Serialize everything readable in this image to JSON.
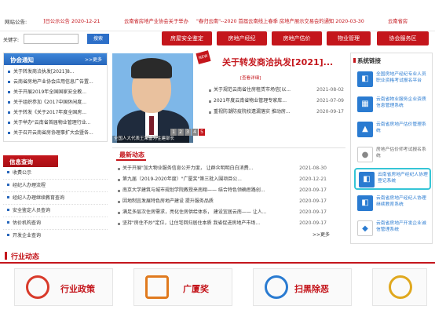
{
  "ticker": {
    "label": "网站公告:",
    "items": [
      {
        "text": "]日公示公告 2020-12-21"
      },
      {
        "text": "云南省房地产业协会关于举办"
      },
      {
        "text": "\"春归云南\"--2020 首届云南线上春季 房地产展示交易会的通知 2020-03-30"
      },
      {
        "text": "云南省房"
      }
    ]
  },
  "toolbar": {
    "keyword_label": "关键字:",
    "search_value": "",
    "search_button": "搜索",
    "nav": [
      "房屋安全鉴定",
      "房地产经纪",
      "房地产估价",
      "物业管理",
      "协会服务区"
    ]
  },
  "notice": {
    "title": "协会通知",
    "more": ">>更多",
    "items": [
      "关于转发商洽执发[2021]8...",
      "云南省房地产业协会应用信息广告置...",
      "关于开展2019年全国国家安全教...",
      "关于组织参加《2017中国休闲度...",
      "关于转发《关于2017年度全国房...",
      "关于举办\"云南省首届物业管理行业...",
      "关于召开云南省房协理事扩大会暨各..."
    ]
  },
  "info": {
    "title": "信息查询",
    "items": [
      "收费公示",
      "经纪人办理流程",
      "经纪人办理继续教育查询",
      "安全鉴定人员查询",
      "估价机构查询",
      "开发企业查询"
    ]
  },
  "feature": {
    "caption": "全国人大代表王荣富为住建部长",
    "pages": [
      "1",
      "2",
      "3",
      "4",
      "5"
    ],
    "active_page": 5,
    "new_badge": "NEW",
    "headline": "关于转发商洽执发[2021]...",
    "detail": "[查看详细]",
    "items": [
      {
        "text": "关于规范云南省住房租赁市场信[以...",
        "date": "2021-08-02"
      },
      {
        "text": "2021年度云南省物业管理专家库...",
        "date": "2021-07-09"
      },
      {
        "text": "重视防潮防疫院校遗漏落实 推动房...",
        "date": "2020-09-17"
      }
    ]
  },
  "news": {
    "title": "最新动态",
    "more": ">>更多",
    "items": [
      {
        "text": "关于开展\"加大物业服务信息公开力度， 让群众明明白白消费...",
        "date": "2021-08-30"
      },
      {
        "text": "第九届（2019-2020年度）\"广厦奖\"第三批入围项目公...",
        "date": "2020-12-21"
      },
      {
        "text": "南京大学建筑与城市规划学院教授来南翔—— 结合特色领确思路创...",
        "date": "2020-09-17"
      },
      {
        "text": "因地制宜发展特色房地产建设 提升服务品质",
        "date": "2020-09-17"
      },
      {
        "text": "满足多层次住房需求，亮化住房供给体系， 建设宜居云南—— 让人...",
        "date": "2020-09-17"
      },
      {
        "text": "坚持\"房住不炒\"定位，让住宅回归居住本质 我省促进房地产市场...",
        "date": "2020-09-17"
      }
    ]
  },
  "systems": {
    "title": "系统链接",
    "items": [
      {
        "text": "全国房地产经纪专业人员职业资格考试报名平台",
        "icon": "id-card-icon"
      },
      {
        "text": "云南省物业服务企业资质信息管理系统",
        "icon": "building-icon"
      },
      {
        "text": "云南省房地产估价管理系统",
        "icon": "chart-icon"
      },
      {
        "text": "房地产估价师考试报名系统",
        "icon": "person-icon"
      },
      {
        "text": "云南省房地产经纪人协理登记系统",
        "icon": "id-card-icon"
      },
      {
        "text": "云南省房地产经纪人协理继续教育系统",
        "icon": "id-card-icon"
      },
      {
        "text": "云南省房地产开发企业诚信管理系统",
        "icon": "shield-icon"
      }
    ]
  },
  "industry": {
    "title": "行业动态",
    "cards": [
      "行业政策",
      "广厦奖",
      "扫黑除恶",
      ""
    ]
  }
}
